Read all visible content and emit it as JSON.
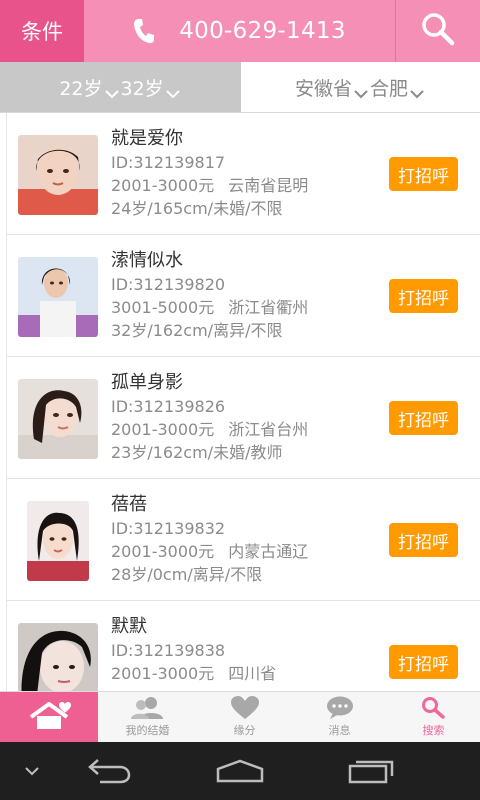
{
  "header": {
    "condition_label": "条件",
    "phone": "400-629-1413",
    "phone_icon": "phone-icon",
    "search_icon": "search-icon"
  },
  "filters": {
    "age_min": "22岁",
    "age_max": "32岁",
    "province": "安徽省",
    "city": "合肥"
  },
  "profiles": [
    {
      "name": "就是爱你",
      "id": "ID:312139817",
      "income": "2001-3000元",
      "location": "云南省昆明",
      "details": "24岁/165cm/未婚/不限",
      "button": "打招呼"
    },
    {
      "name": "溹情似水",
      "id": "ID:312139820",
      "income": "3001-5000元",
      "location": "浙江省衢州",
      "details": "32岁/162cm/离异/不限",
      "button": "打招呼"
    },
    {
      "name": "孤单身影",
      "id": "ID:312139826",
      "income": "2001-3000元",
      "location": "浙江省台州",
      "details": "23岁/162cm/未婚/教师",
      "button": "打招呼"
    },
    {
      "name": "蓓蓓",
      "id": "ID:312139832",
      "income": "2001-3000元",
      "location": "内蒙古通辽",
      "details": "28岁/0cm/离异/不限",
      "button": "打招呼"
    },
    {
      "name": "默默",
      "id": "ID:312139838",
      "income": "2001-3000元",
      "location": "四川省",
      "details": "",
      "button": "打招呼"
    }
  ],
  "tabs": [
    {
      "label": "",
      "icon": "home-heart-icon"
    },
    {
      "label": "我的结婚",
      "icon": "users-icon"
    },
    {
      "label": "缘分",
      "icon": "heart-icon"
    },
    {
      "label": "消息",
      "icon": "chat-icon"
    },
    {
      "label": "搜索",
      "icon": "search-icon"
    }
  ],
  "colors": {
    "brand_pink": "#f58fb5",
    "brand_pink_dark": "#e9538c",
    "accent_orange": "#ff9a00"
  }
}
